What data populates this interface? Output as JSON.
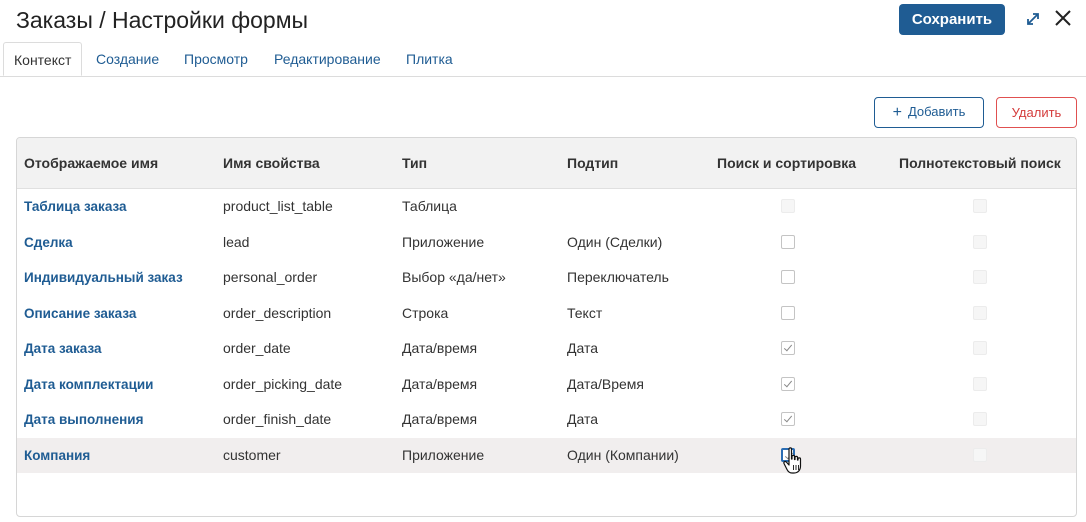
{
  "header": {
    "title": "Заказы / Настройки формы",
    "save_label": "Сохранить"
  },
  "tabs": [
    {
      "label": "Контекст",
      "active": true
    },
    {
      "label": "Создание",
      "active": false
    },
    {
      "label": "Просмотр",
      "active": false
    },
    {
      "label": "Редактирование",
      "active": false
    },
    {
      "label": "Плитка",
      "active": false
    }
  ],
  "actions": {
    "add_label": "Добавить",
    "delete_label": "Удалить"
  },
  "table": {
    "columns": [
      "Отображаемое имя",
      "Имя свойства",
      "Тип",
      "Подтип",
      "Поиск и сортировка",
      "Полнотекстовый поиск"
    ],
    "rows": [
      {
        "name": "Таблица заказа",
        "property": "product_list_table",
        "type": "Таблица",
        "subtype": "",
        "search": "disabled",
        "fulltext": "disabled"
      },
      {
        "name": "Сделка",
        "property": "lead",
        "type": "Приложение",
        "subtype": "Один (Сделки)",
        "search": "unchecked",
        "fulltext": "disabled"
      },
      {
        "name": "Индивидуальный заказ",
        "property": "personal_order",
        "type": "Выбор «да/нет»",
        "subtype": "Переключатель",
        "search": "unchecked",
        "fulltext": "disabled"
      },
      {
        "name": "Описание заказа",
        "property": "order_description",
        "type": "Строка",
        "subtype": "Текст",
        "search": "unchecked",
        "fulltext": "disabled"
      },
      {
        "name": "Дата заказа",
        "property": "order_date",
        "type": "Дата/время",
        "subtype": "Дата",
        "search": "checked",
        "fulltext": "disabled"
      },
      {
        "name": "Дата комплектации",
        "property": "order_picking_date",
        "type": "Дата/время",
        "subtype": "Дата/Время",
        "search": "checked",
        "fulltext": "disabled"
      },
      {
        "name": "Дата выполнения",
        "property": "order_finish_date",
        "type": "Дата/время",
        "subtype": "Дата",
        "search": "checked",
        "fulltext": "disabled"
      },
      {
        "name": "Компания",
        "property": "customer",
        "type": "Приложение",
        "subtype": "Один (Компании)",
        "search": "checked-focused",
        "fulltext": "disabled"
      }
    ]
  },
  "colors": {
    "primary": "#1f5c93",
    "danger": "#d43c3c",
    "hover_row": "#f1eeee"
  },
  "icons": {
    "expand": "expand-icon",
    "close": "close-icon",
    "plus": "plus-icon",
    "cursor": "hand-pointer-icon"
  }
}
